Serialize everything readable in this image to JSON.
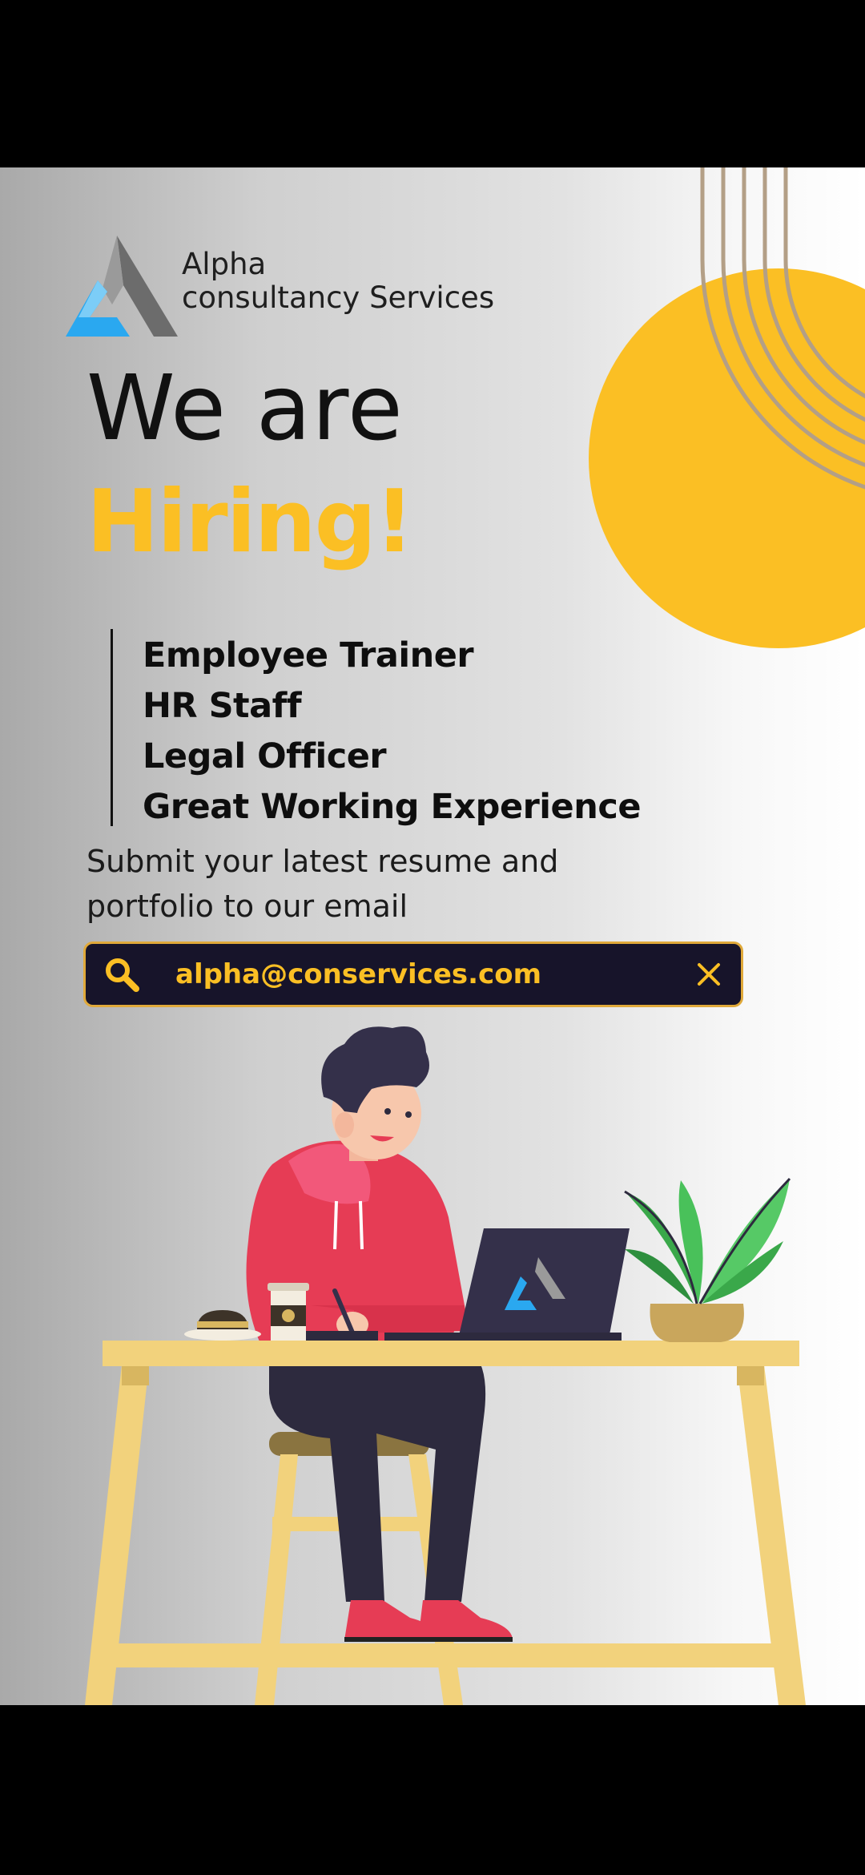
{
  "brand": {
    "line1": "Alpha",
    "line2": "consultancy Services"
  },
  "headline": {
    "line1": "We are",
    "line2": "Hiring!"
  },
  "roles": [
    "Employee Trainer",
    "HR Staff",
    "Legal Officer",
    "Great Working Experience"
  ],
  "submit": {
    "line1": "Submit your latest resume and",
    "line2": "portfolio to our email"
  },
  "email": {
    "address": "alpha@conservices.com"
  },
  "icons": {
    "search": "search-icon",
    "close": "close-icon",
    "logo": "alpha-logo-icon"
  },
  "colors": {
    "accent": "#fbbf24",
    "dark": "#17142a",
    "blue": "#2aa8f0",
    "hoodie": "#e63c55"
  }
}
